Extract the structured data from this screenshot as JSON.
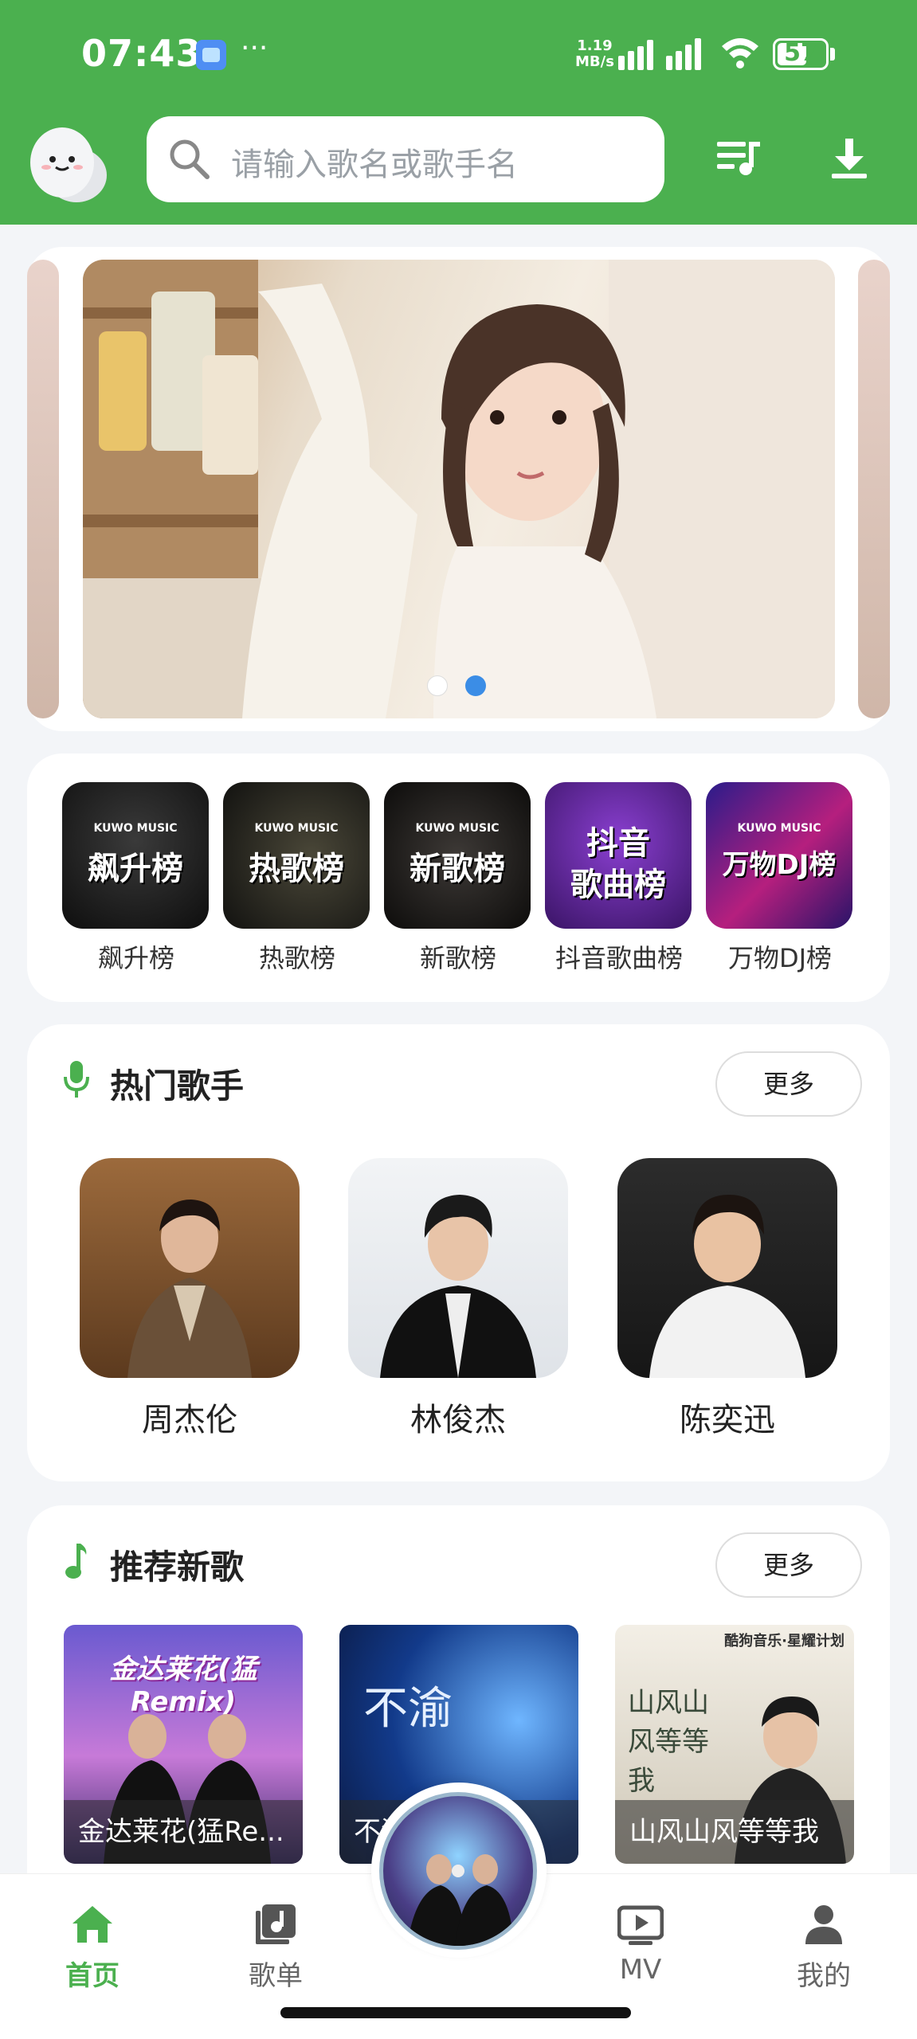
{
  "status_bar": {
    "time": "07:43",
    "dots": "···",
    "speed_value": "1.19",
    "speed_unit": "MB/s",
    "battery": "57"
  },
  "header": {
    "search_placeholder": "请输入歌名或歌手名"
  },
  "banner": {
    "page_count": 2,
    "active_page": 2
  },
  "charts": {
    "items": [
      {
        "label": "飙升榜",
        "cover_text": "飙升榜",
        "brand": "KUWO MUSIC"
      },
      {
        "label": "热歌榜",
        "cover_text": "热歌榜",
        "brand": "KUWO MUSIC"
      },
      {
        "label": "新歌榜",
        "cover_text": "新歌榜",
        "brand": "KUWO MUSIC"
      },
      {
        "label": "抖音歌曲榜",
        "cover_text_1": "抖音",
        "cover_text_2": "歌曲榜"
      },
      {
        "label": "万物DJ榜",
        "cover_text": "万物DJ榜",
        "brand": "KUWO MUSIC"
      }
    ]
  },
  "hot_singers": {
    "title": "热门歌手",
    "more": "更多",
    "items": [
      {
        "name": "周杰伦"
      },
      {
        "name": "林俊杰"
      },
      {
        "name": "陈奕迅"
      }
    ]
  },
  "new_songs": {
    "title": "推荐新歌",
    "more": "更多",
    "items": [
      {
        "caption": "金达莱花(猛Re...",
        "cover_text": "金达莱花(猛Remix)"
      },
      {
        "caption": "不渝",
        "cover_text": "不渝"
      },
      {
        "caption": "山风山风等等我",
        "cover_text": "山风山风等等我",
        "top_text": "酷狗音乐·星耀计划"
      }
    ]
  },
  "nav": {
    "items": [
      {
        "label": "首页"
      },
      {
        "label": "歌单"
      },
      {
        "label": "MV"
      },
      {
        "label": "我的"
      }
    ]
  },
  "colors": {
    "accent": "#4bb04f",
    "background": "#f3f5f8",
    "card": "#ffffff",
    "dot_active": "#3b8de6"
  },
  "icons": {
    "search": "magnifier-icon",
    "playlist": "music-queue-icon",
    "download": "download-icon",
    "singer_section": "microphone-icon",
    "song_section": "music-note-icon",
    "nav_home": "home-icon",
    "nav_playlist": "album-icon",
    "nav_mv": "tv-play-icon",
    "nav_me": "person-icon"
  }
}
